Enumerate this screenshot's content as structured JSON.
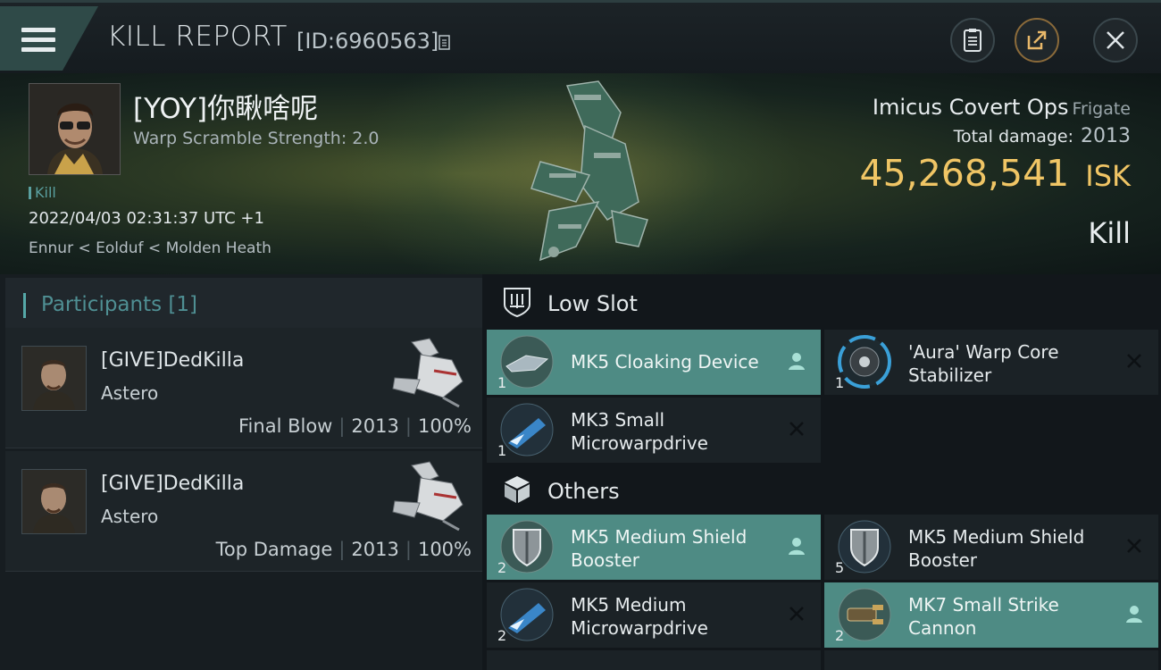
{
  "header": {
    "title": "KILL REPORT",
    "report_id": "[ID:6960563]"
  },
  "victim": {
    "name": "[YOY]你瞅啥呢",
    "scramble": "Warp Scramble Strength: 2.0",
    "tag": "Kill",
    "timestamp": "2022/04/03 02:31:37 UTC +1",
    "location": "Ennur < Eolduf < Molden Heath",
    "ship_name": "Imicus Covert Ops",
    "ship_class": "Frigate",
    "total_damage_label": "Total damage:",
    "total_damage": "2013",
    "isk_value": "45,268,541",
    "isk_unit": "ISK",
    "outcome": "Kill"
  },
  "participants": {
    "title": "Participants [1]",
    "rows": [
      {
        "name": "[GIVE]DedKilla",
        "ship": "Astero",
        "role": "Final Blow",
        "damage": "2013",
        "percent": "100%"
      },
      {
        "name": "[GIVE]DedKilla",
        "ship": "Astero",
        "role": "Top Damage",
        "damage": "2013",
        "percent": "100%"
      }
    ]
  },
  "sections": {
    "low_slot": "Low Slot",
    "others": "Others"
  },
  "low_slot_items": [
    {
      "name": "MK5 Cloaking Device",
      "qty": "1",
      "status": "dropped"
    },
    {
      "name": "'Aura' Warp Core Stabilizer",
      "qty": "1",
      "status": "destroyed"
    },
    {
      "name": "MK3 Small Microwarpdrive",
      "qty": "1",
      "status": "destroyed"
    }
  ],
  "other_items": [
    {
      "name": "MK5 Medium Shield Booster",
      "qty": "2",
      "status": "dropped"
    },
    {
      "name": "MK5 Medium Shield Booster",
      "qty": "5",
      "status": "destroyed"
    },
    {
      "name": "MK5 Medium Microwarpdrive",
      "qty": "2",
      "status": "destroyed"
    },
    {
      "name": "MK7 Small Strike Cannon",
      "qty": "2",
      "status": "dropped"
    }
  ],
  "colors": {
    "accent": "#4e8b84",
    "isk": "#f0c565",
    "teal_text": "#4f8f93"
  }
}
